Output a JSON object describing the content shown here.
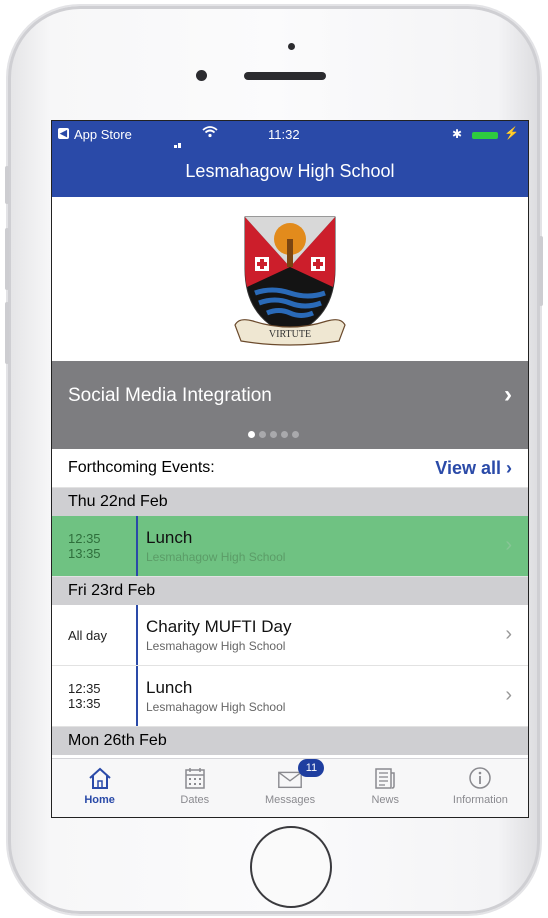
{
  "status_bar": {
    "back_app": "App Store",
    "time": "11:32"
  },
  "header": {
    "title": "Lesmahagow High School"
  },
  "crest": {
    "motto": "VIRTUTE",
    "colors": {
      "shield_red": "#cc1e2b",
      "shield_black": "#141414",
      "tree": "#e28b1c"
    }
  },
  "banner": {
    "text": "Social Media Integration",
    "page_count": 5,
    "active_page": 0
  },
  "events": {
    "header_label": "Forthcoming Events:",
    "view_all": "View all",
    "days": [
      {
        "label": "Thu 22nd Feb",
        "items": [
          {
            "start": "12:35",
            "end": "13:35",
            "name": "Lunch",
            "location": "Lesmahagow High School",
            "highlight": true
          }
        ]
      },
      {
        "label": "Fri 23rd Feb",
        "items": [
          {
            "start": "All day",
            "name": "Charity MUFTI Day",
            "location": "Lesmahagow High School"
          },
          {
            "start": "12:35",
            "end": "13:35",
            "name": "Lunch",
            "location": "Lesmahagow High School"
          }
        ]
      },
      {
        "label": "Mon 26th Feb"
      }
    ]
  },
  "tabs": [
    {
      "label": "Home",
      "icon": "home-icon",
      "active": true
    },
    {
      "label": "Dates",
      "icon": "calendar-icon"
    },
    {
      "label": "Messages",
      "icon": "envelope-icon",
      "badge": "11"
    },
    {
      "label": "News",
      "icon": "newspaper-icon"
    },
    {
      "label": "Information",
      "icon": "info-icon"
    }
  ],
  "theme": {
    "accent": "#2a4aa8",
    "highlight": "#6fc282"
  }
}
